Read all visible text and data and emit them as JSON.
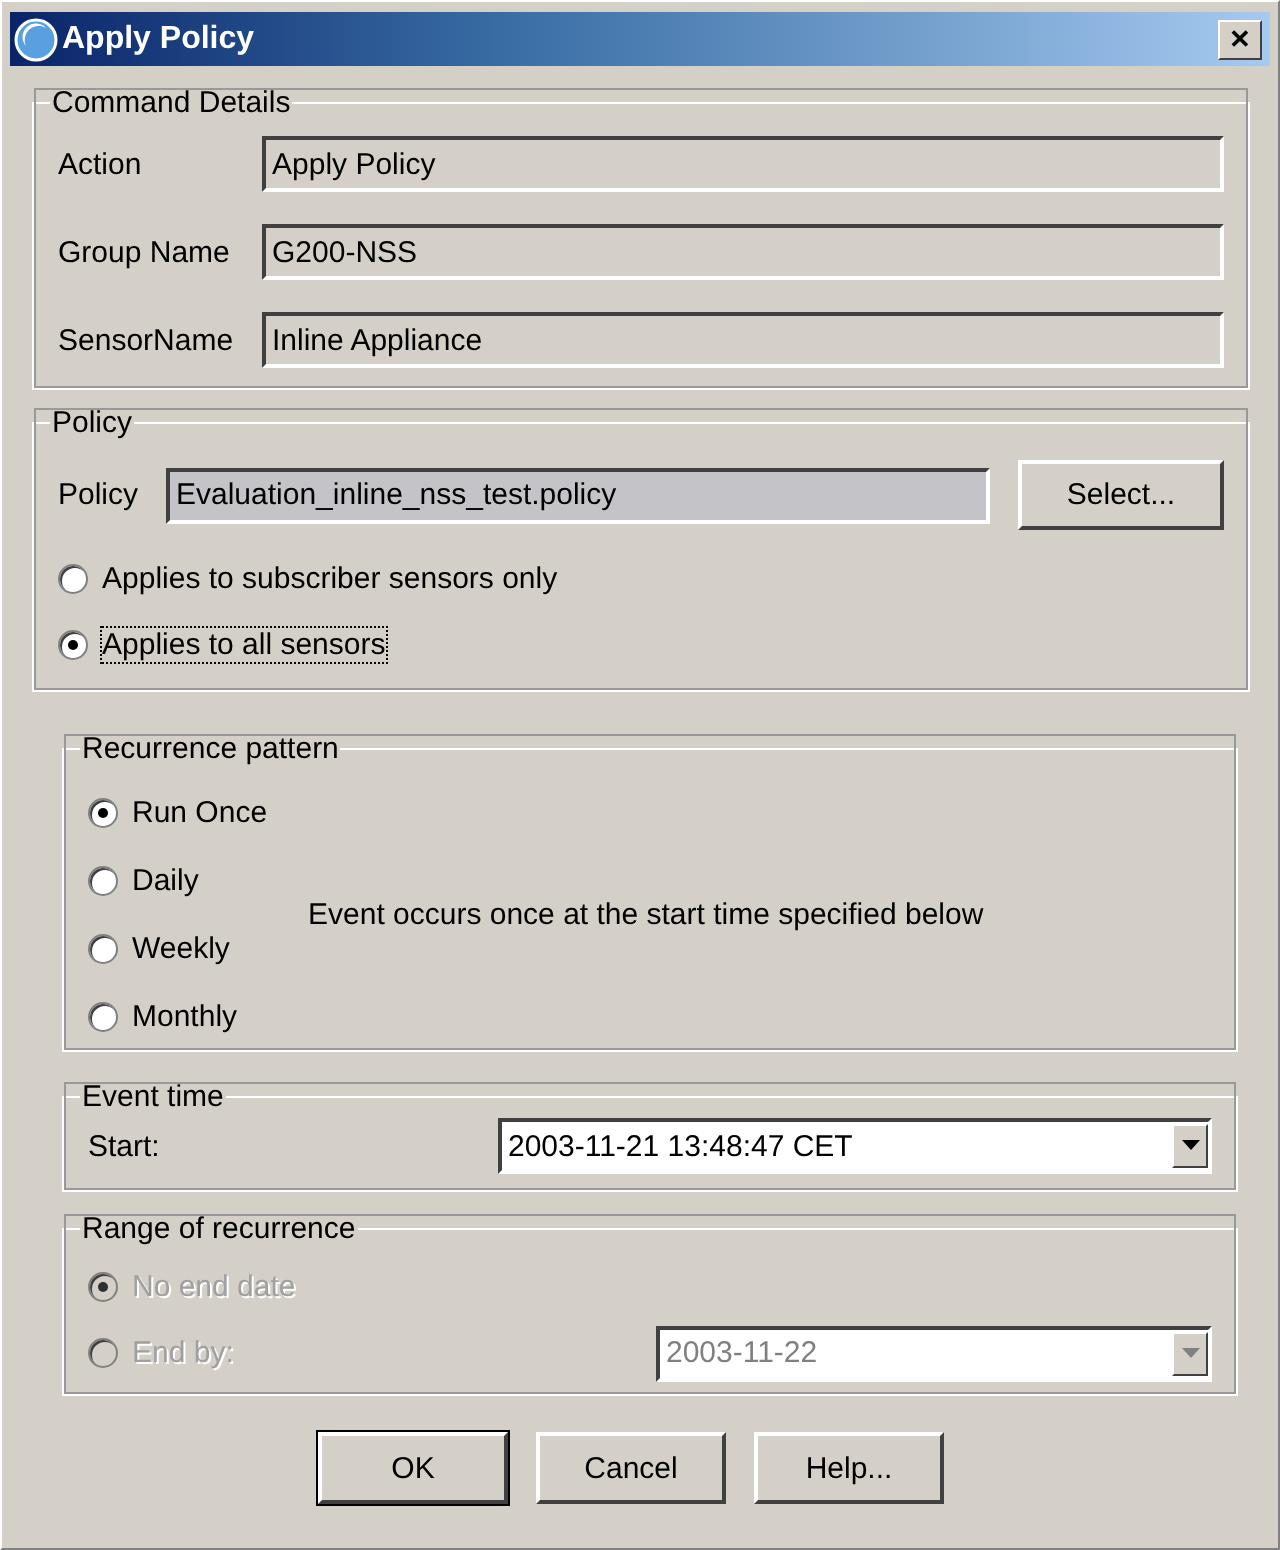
{
  "window": {
    "title": "Apply Policy",
    "close": "✕"
  },
  "command_details": {
    "legend": "Command Details",
    "fields": [
      {
        "label": "Action",
        "value": "Apply Policy"
      },
      {
        "label": "Group Name",
        "value": "G200-NSS"
      },
      {
        "label": "SensorName",
        "value": "Inline Appliance"
      }
    ]
  },
  "policy": {
    "legend": "Policy",
    "label": "Policy",
    "value": "Evaluation_inline_nss_test.policy",
    "select_button": "Select...",
    "options": [
      {
        "label": "Applies to subscriber sensors only",
        "selected": false,
        "focused": false
      },
      {
        "label": "Applies to all sensors",
        "selected": true,
        "focused": true
      }
    ]
  },
  "recurrence": {
    "legend": "Recurrence pattern",
    "options": [
      {
        "label": "Run Once",
        "selected": true
      },
      {
        "label": "Daily",
        "selected": false
      },
      {
        "label": "Weekly",
        "selected": false
      },
      {
        "label": "Monthly",
        "selected": false
      }
    ],
    "description": "Event occurs once at the start time specified below"
  },
  "event_time": {
    "legend": "Event time",
    "label": "Start:",
    "value": "2003-11-21 13:48:47 CET"
  },
  "range": {
    "legend": "Range of recurrence",
    "disabled": true,
    "options": [
      {
        "label": "No end date",
        "selected": true
      },
      {
        "label": "End by:",
        "selected": false
      }
    ],
    "end_date": "2003-11-22"
  },
  "buttons": [
    "OK",
    "Cancel",
    "Help..."
  ]
}
